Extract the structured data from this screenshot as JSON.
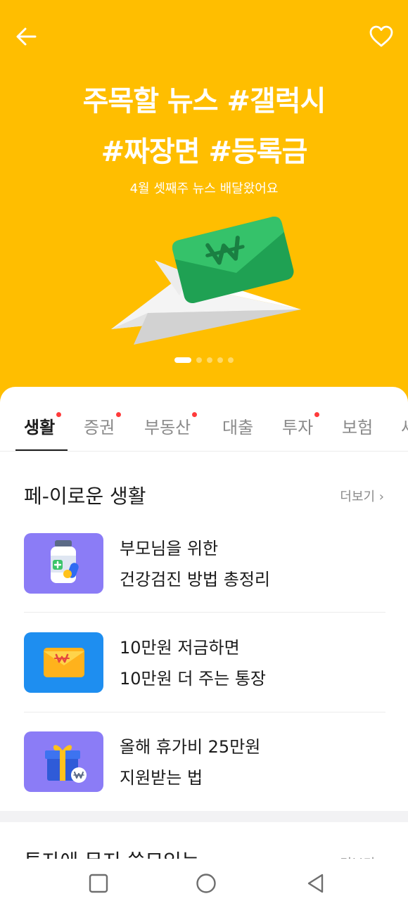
{
  "hero": {
    "title_line1": "주목할 뉴스 #갤럭시",
    "title_line2": "#짜장면 #등록금",
    "subtitle": "4월 셋째주 뉴스 배달왔어요",
    "back_icon": "arrow-left-icon",
    "favorite_icon": "heart-outline-icon",
    "background_color": "#ffbe00",
    "pager": {
      "count": 5,
      "active_index": 0
    }
  },
  "tabs": [
    {
      "label": "생활",
      "active": true,
      "has_badge": true
    },
    {
      "label": "증권",
      "active": false,
      "has_badge": true
    },
    {
      "label": "부동산",
      "active": false,
      "has_badge": true
    },
    {
      "label": "대출",
      "active": false,
      "has_badge": false
    },
    {
      "label": "투자",
      "active": false,
      "has_badge": true
    },
    {
      "label": "보험",
      "active": false,
      "has_badge": false
    },
    {
      "label": "세",
      "active": false,
      "has_badge": false
    }
  ],
  "section": {
    "title": "페-이로운 생활",
    "more_label": "더보기 ›",
    "items": [
      {
        "line1": "부모님을 위한",
        "line2": "건강검진 방법 총정리",
        "thumb_color": "#8b7cf6",
        "icon": "medicine-bottle-icon"
      },
      {
        "line1": "10만원 저금하면",
        "line2": "10만원 더 주는 통장",
        "thumb_color": "#1e8ef0",
        "icon": "envelope-won-icon"
      },
      {
        "line1": "올해 휴가비 25만원",
        "line2": "지원받는 법",
        "thumb_color": "#8b7cf6",
        "icon": "gift-box-icon"
      }
    ]
  },
  "next_section": {
    "title": "투자에 무지 쓸모있는",
    "more_label": "더보기 ›"
  },
  "nav": {
    "recents_icon": "square-recents-icon",
    "home_icon": "circle-home-icon",
    "back_icon": "triangle-back-icon"
  }
}
